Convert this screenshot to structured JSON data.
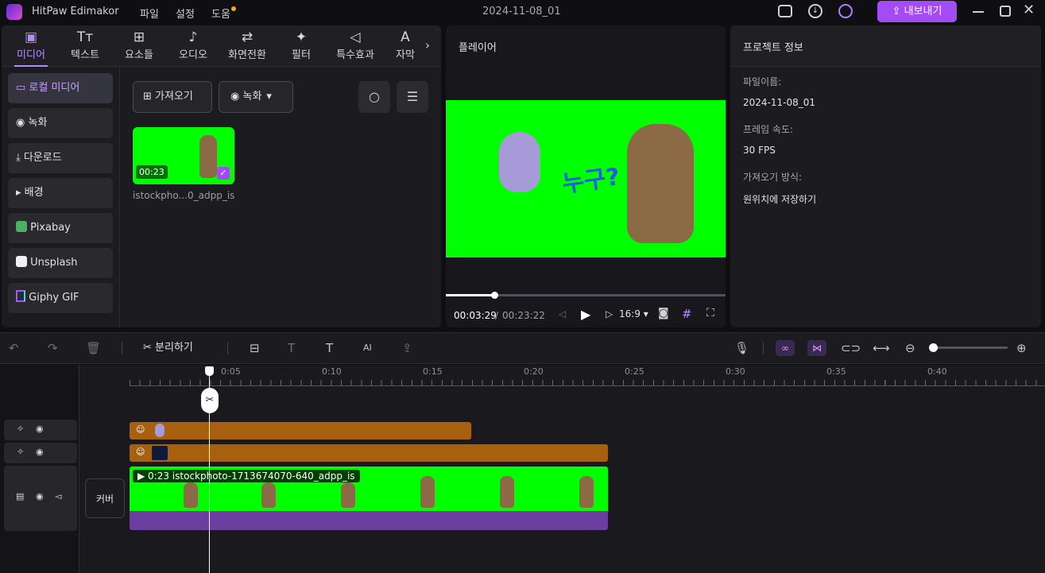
{
  "app": {
    "name": "HitPaw Edimakor",
    "menus": [
      "파일",
      "설정",
      "도움"
    ],
    "project_title": "2024-11-08_01",
    "export_label": "내보내기"
  },
  "tabs": [
    {
      "label": "미디어",
      "icon": "image-icon"
    },
    {
      "label": "텍스트",
      "icon": "text-icon"
    },
    {
      "label": "요소들",
      "icon": "elements-icon"
    },
    {
      "label": "오디오",
      "icon": "music-icon"
    },
    {
      "label": "화면전환",
      "icon": "transition-icon"
    },
    {
      "label": "필터",
      "icon": "sparkle-icon"
    },
    {
      "label": "특수효과",
      "icon": "effects-icon"
    },
    {
      "label": "자막",
      "icon": "subtitle-icon"
    }
  ],
  "sidebar": {
    "items": [
      "로컬 미디어",
      "녹화",
      "다운로드",
      "배경",
      "Pixabay",
      "Unsplash",
      "Giphy GIF"
    ]
  },
  "media": {
    "import_label": "가져오기",
    "record_label": "녹화",
    "clip_duration": "00:23",
    "clip_name": "istockpho...0_adpp_is"
  },
  "player": {
    "title": "플레이어",
    "current_time": "00:03:29",
    "separator": "/",
    "total_time": "00:23:22",
    "aspect": "16:9",
    "progress": 0.15,
    "subtitle_text": "누구?"
  },
  "project_info": {
    "title": "프로젝트 정보",
    "file_name_label": "파일이름:",
    "file_name": "2024-11-08_01",
    "frame_rate_label": "프레임 속도:",
    "frame_rate": "30 FPS",
    "import_method_label": "가져오기 방식:",
    "import_method": "원위치에 저장하기"
  },
  "timeline": {
    "split_label": "분리하기",
    "ticks": [
      "0:05",
      "0:10",
      "0:15",
      "0:20",
      "0:25",
      "0:30",
      "0:35",
      "0:40"
    ],
    "cover_label": "커버",
    "main_clip_label": "0:23 istockphoto-1713674070-640_adpp_is",
    "zoom_level": 0.05
  },
  "colors": {
    "accent": "#a34cf5",
    "chroma_green": "#00ff00",
    "sticker_track": "#a7610e",
    "audio_track": "#6b3fa0"
  }
}
